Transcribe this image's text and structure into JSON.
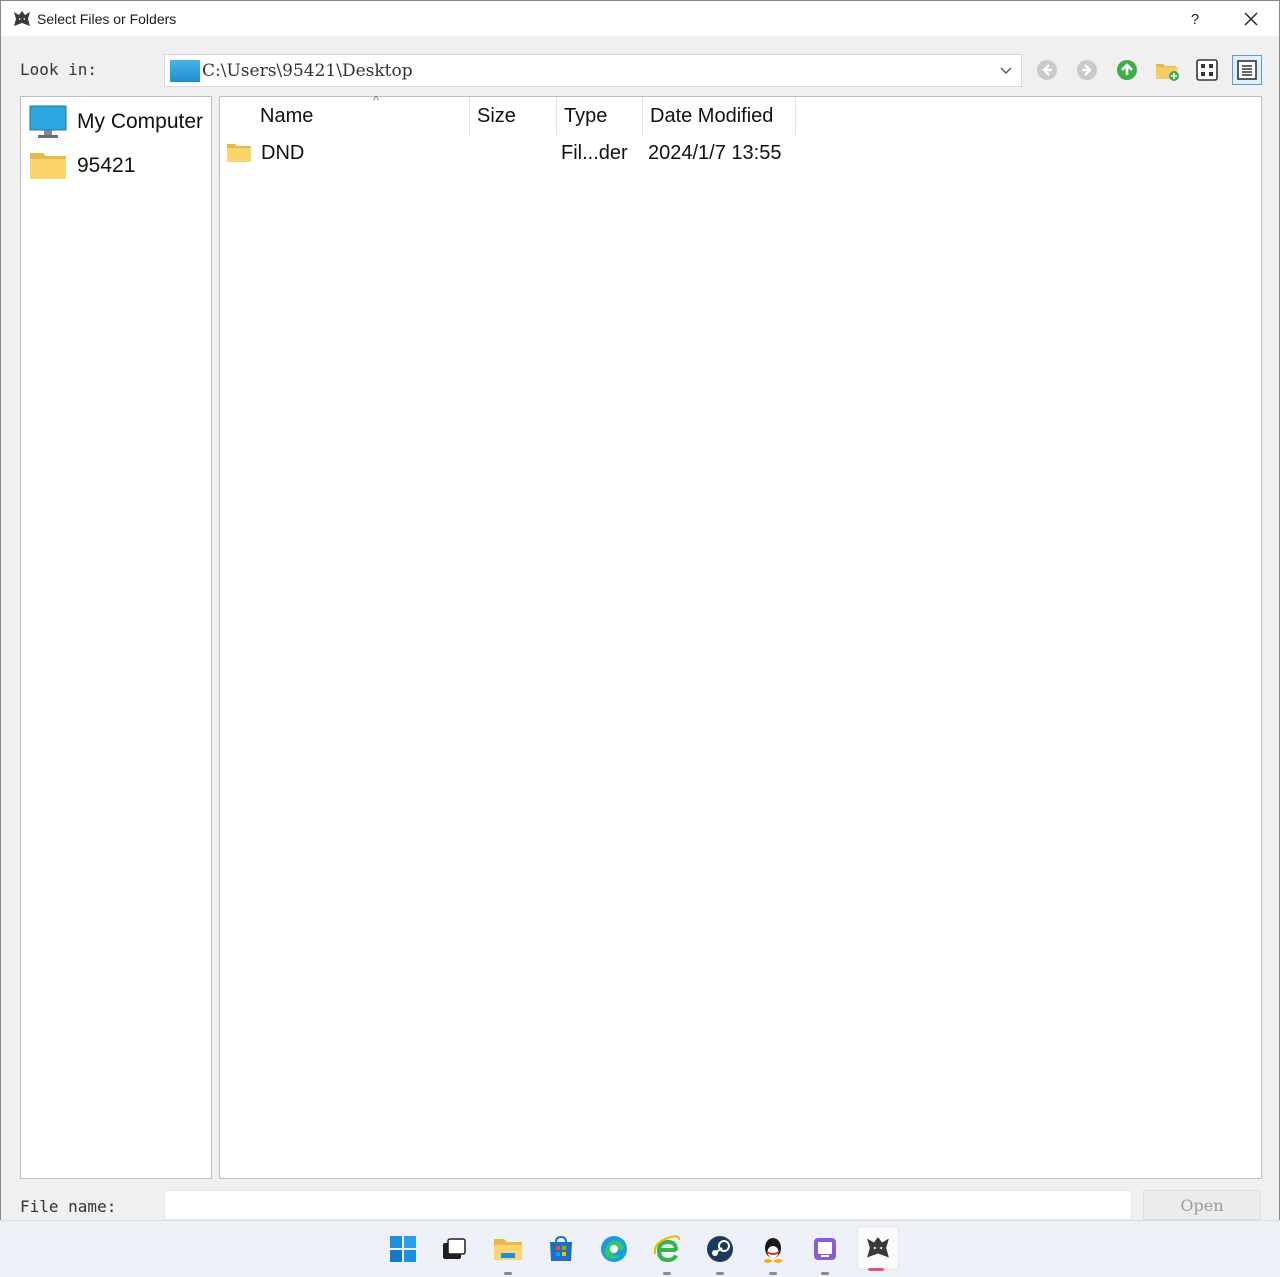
{
  "window": {
    "title": "Select Files or Folders",
    "help_label": "?",
    "close_label": "✕"
  },
  "lookin": {
    "label": "Look in:",
    "path": "C:\\Users\\95421\\Desktop"
  },
  "toolbar": {
    "buttons": [
      "back-icon",
      "forward-icon",
      "up-folder-icon",
      "new-folder-icon",
      "icon-view-icon",
      "detail-view-icon"
    ]
  },
  "sidebar": {
    "items": [
      {
        "label": "My Computer",
        "icon": "computer-icon"
      },
      {
        "label": "95421",
        "icon": "folder-icon"
      }
    ]
  },
  "columns": {
    "name": "Name",
    "size": "Size",
    "type": "Type",
    "date": "Date Modified",
    "sort_indicator": "^"
  },
  "files": [
    {
      "name": "DND",
      "size": "",
      "type": "Fil...der",
      "date": "2024/1/7 13:55",
      "icon": "folder-icon"
    }
  ],
  "filename": {
    "label": "File name:",
    "value": ""
  },
  "open_button": "Open",
  "taskbar": {
    "apps": [
      "windows-start-icon",
      "task-view-icon",
      "file-explorer-icon",
      "microsoft-store-icon",
      "edge-icon",
      "ie-icon",
      "steam-icon",
      "qq-icon",
      "app-icon",
      "wolf-app-icon"
    ]
  },
  "colors": {
    "accent": "#1e8fd0",
    "active_indicator": "#e0527a"
  }
}
